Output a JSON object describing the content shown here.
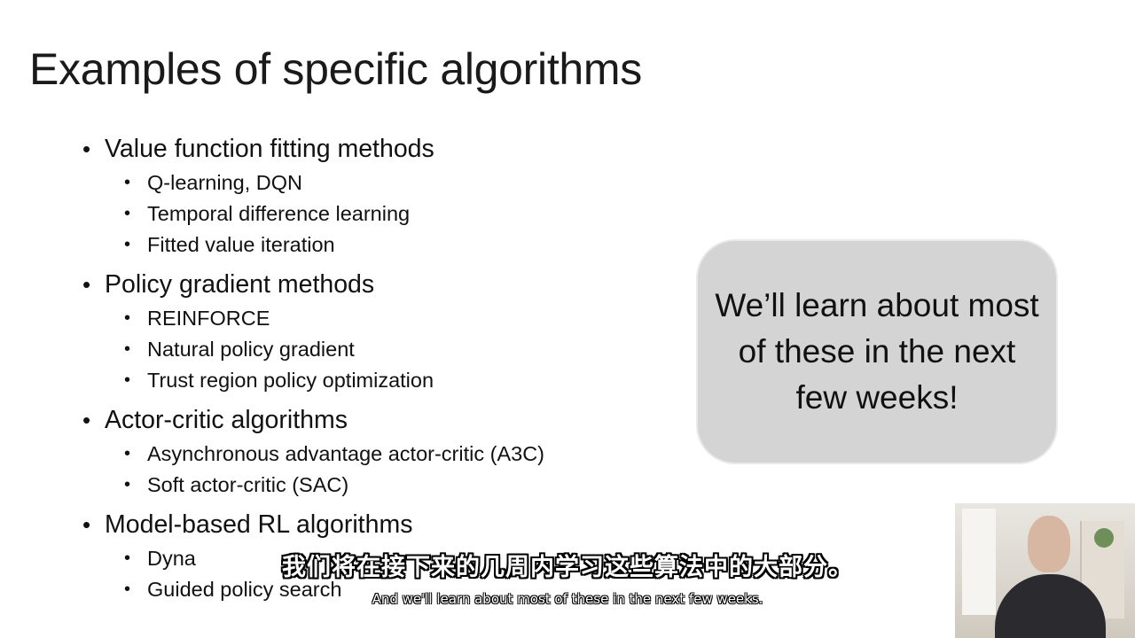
{
  "slide": {
    "title": "Examples of specific algorithms",
    "watermark": "",
    "sections": [
      {
        "label": "Value function fitting methods",
        "items": [
          "Q-learning, DQN",
          "Temporal difference learning",
          "Fitted value iteration"
        ]
      },
      {
        "label": "Policy gradient methods",
        "items": [
          "REINFORCE",
          "Natural policy gradient",
          "Trust region policy optimization"
        ]
      },
      {
        "label": "Actor-critic algorithms",
        "items": [
          "Asynchronous advantage actor-critic (A3C)",
          "Soft actor-critic (SAC)"
        ]
      },
      {
        "label": "Model-based RL algorithms",
        "items": [
          "Dyna",
          "Guided policy search"
        ]
      }
    ],
    "callout": {
      "text": "We’ll learn about most of these in the next few weeks!",
      "background": "#d4d4d4"
    }
  },
  "subtitles": {
    "zh": "我们将在接下来的几周内学习这些算法中的大部分。",
    "en": "And we'll learn about most of these in the next few weeks."
  }
}
